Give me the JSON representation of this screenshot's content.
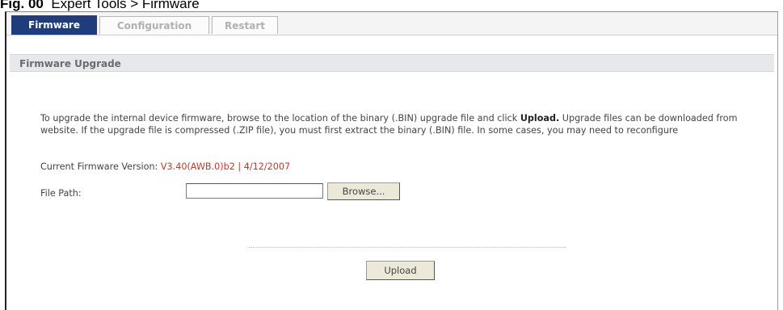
{
  "caption": {
    "figure_label": "Fig. 00",
    "breadcrumb": "Expert Tools > Firmware"
  },
  "tabs": [
    {
      "label": "Firmware",
      "active": true
    },
    {
      "label": "Configuration",
      "active": false
    },
    {
      "label": "Restart",
      "active": false
    }
  ],
  "section": {
    "title": "Firmware Upgrade"
  },
  "description": {
    "text_before": "To upgrade the internal device firmware, browse to the location of the binary (.BIN) upgrade file and click ",
    "bold": "Upload.",
    "text_after": " Upgrade files can be downloaded from website. If the upgrade file is compressed (.ZIP file), you must first extract the binary (.BIN) file. In some cases, you may need to reconfigure"
  },
  "firmware": {
    "label": "Current Firmware Version: ",
    "version": "V3.40(AWB.0)b2 | 4/12/2007"
  },
  "file_path": {
    "label": "File Path:",
    "value": "",
    "browse_label": "Browse..."
  },
  "upload": {
    "label": "Upload"
  },
  "colors": {
    "active_tab": "#1f3d7a",
    "version_text": "#c0392b",
    "section_header_bg": "#e6e8ec"
  }
}
